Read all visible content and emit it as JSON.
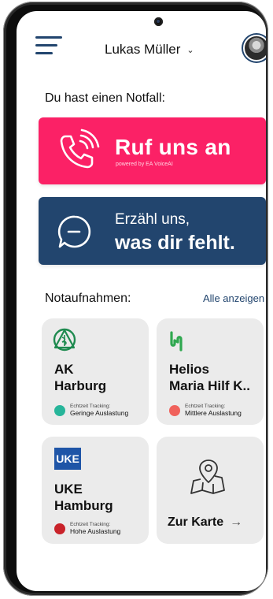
{
  "header": {
    "user_name": "Lukas Müller",
    "chevron": "chevron-down-icon"
  },
  "emergency": {
    "heading": "Du hast einen Notfall:",
    "call": {
      "title": "Ruf uns an",
      "subtitle": "powered by EA VoiceAI",
      "icon": "phone-call-icon",
      "color": "#fb2166"
    },
    "chat": {
      "line1": "Erzähl uns,",
      "line2": "was dir fehlt.",
      "icon": "chat-bubble-icon",
      "color": "#22456e"
    }
  },
  "er_section": {
    "heading": "Notaufnahmen:",
    "show_all": "Alle anzeigen",
    "hospitals": [
      {
        "name_line1": "AK",
        "name_line2": "Harburg",
        "tracking_label": "Echtzeit Tracking:",
        "load": "Geringe Auslastung",
        "status_color": "#27b59a"
      },
      {
        "name_line1": "Helios",
        "name_line2": "Maria Hilf K..",
        "tracking_label": "Echtzeit Tracking:",
        "load": "Mittlere Auslastung",
        "status_color": "#f0625c"
      },
      {
        "name_line1": "UKE",
        "name_line2": "Hamburg",
        "logo": "UKE",
        "tracking_label": "Echtzeit Tracking:",
        "load": "Hohe Auslastung",
        "status_color": "#c9232a"
      }
    ],
    "map_tile": {
      "label": "Zur Karte",
      "arrow": "→",
      "icon": "map-pin-icon"
    }
  }
}
